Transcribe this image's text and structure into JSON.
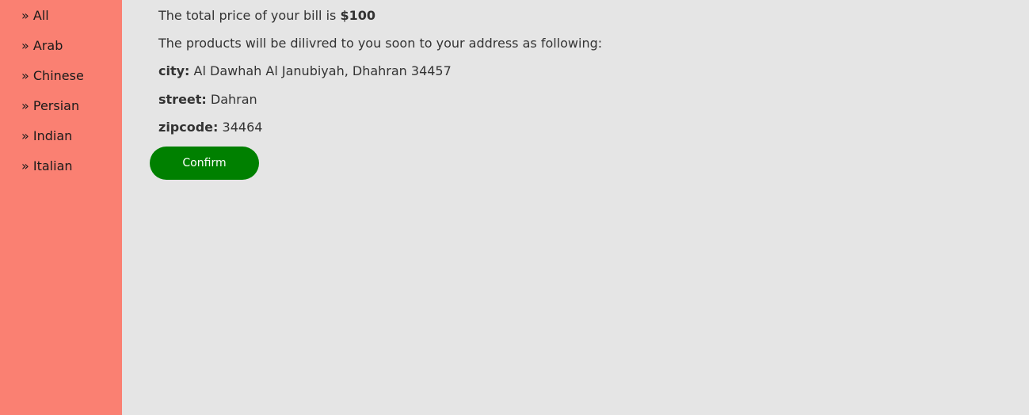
{
  "sidebar": {
    "items": [
      {
        "label": "» All"
      },
      {
        "label": "» Arab"
      },
      {
        "label": "» Chinese"
      },
      {
        "label": "» Persian"
      },
      {
        "label": "» Indian"
      },
      {
        "label": "» Italian"
      }
    ]
  },
  "bill": {
    "text": "The total price of your bill is ",
    "amount": "$100"
  },
  "delivery_text": "The products will be dilivred to you soon to your address as following:",
  "address": {
    "city_label": "city:",
    "city": "Al Dawhah Al Janubiyah, Dhahran 34457",
    "street_label": "street:",
    "street": "Dahran",
    "zipcode_label": "zipcode:",
    "zipcode": "34464"
  },
  "confirm_label": "Confirm",
  "colors": {
    "sidebar": "#fa8072",
    "background": "#e5e5e5",
    "button": "#008000"
  }
}
